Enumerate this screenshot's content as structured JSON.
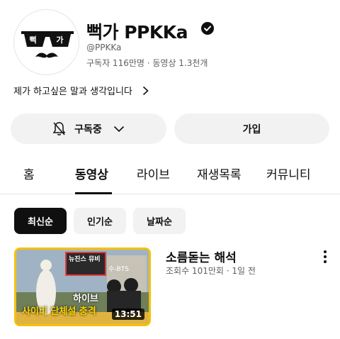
{
  "channel": {
    "name": "뻑가 PPKKa",
    "handle": "@PPKKa",
    "stats": "구독자 116만명 · 동영상 1.3천개",
    "description": "제가 하고싶은 말과 생각입니다",
    "avatar_text": "뻑 가"
  },
  "buttons": {
    "subscribe_label": "구독중",
    "join_label": "가입"
  },
  "tabs": [
    {
      "label": "홈"
    },
    {
      "label": "동영상"
    },
    {
      "label": "라이브"
    },
    {
      "label": "재생목록"
    },
    {
      "label": "커뮤니티"
    }
  ],
  "active_tab": "동영상",
  "chips": [
    {
      "label": "최신순"
    },
    {
      "label": "인기순"
    },
    {
      "label": "날짜순"
    }
  ],
  "video": {
    "title": "소름돋는 해석",
    "meta": "조회수 101만회 · 1일 전",
    "duration": "13:51",
    "thumb_texts": [
      "뉴진스 뮤비",
      "수-BTS",
      "하이브",
      "사이비 단체설 충격"
    ]
  },
  "colors": {
    "accent": "#f4c20d",
    "chip_active": "#0f0f0f",
    "button_bg": "#f2f2f2",
    "muted_text": "#606060"
  },
  "icons": [
    "verified-badge-icon",
    "chevron-right-icon",
    "bell-off-icon",
    "chevron-down-icon",
    "more-vert-icon"
  ]
}
